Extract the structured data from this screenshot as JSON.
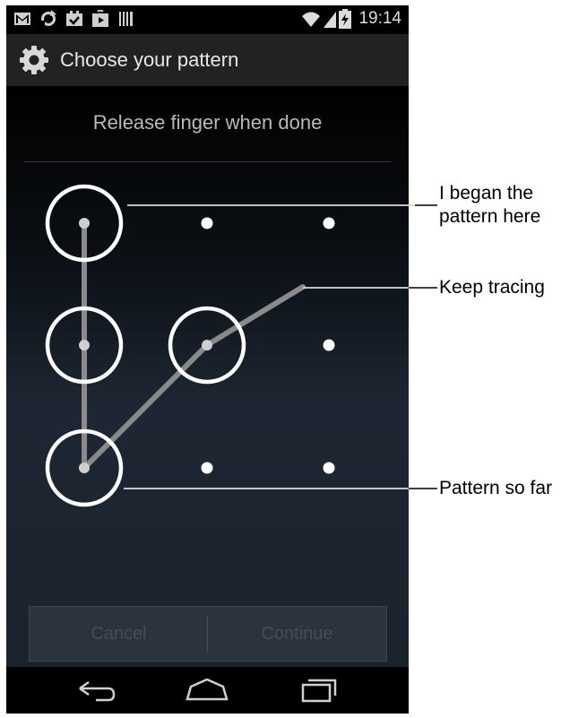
{
  "status_bar": {
    "icons": [
      "gmail-icon",
      "sync-icon",
      "calendar-check-icon",
      "play-store-icon",
      "barcode-icon",
      "wifi-icon",
      "signal-icon",
      "battery-charging-icon"
    ],
    "time": "19:14"
  },
  "action_bar": {
    "icon": "settings-gear-icon",
    "title": "Choose your pattern"
  },
  "header": {
    "text": "Release finger when done"
  },
  "pattern": {
    "grid": "3x3",
    "selected_dots": [
      [
        0,
        0
      ],
      [
        1,
        0
      ],
      [
        2,
        0
      ],
      [
        1,
        1
      ]
    ],
    "trace_end": "in progress toward top-right"
  },
  "buttons": {
    "cancel": "Cancel",
    "continue": "Continue"
  },
  "nav_bar": {
    "icons": [
      "back-icon",
      "home-icon",
      "recent-apps-icon"
    ]
  },
  "callouts": {
    "began_line1": "I began the",
    "began_line2": "pattern here",
    "keep_tracing": "Keep tracing",
    "so_far": "Pattern so far"
  },
  "colors": {
    "accent_ring": "#ffffff",
    "trace_line": "#8a8a8a",
    "action_bar": "#222222"
  }
}
